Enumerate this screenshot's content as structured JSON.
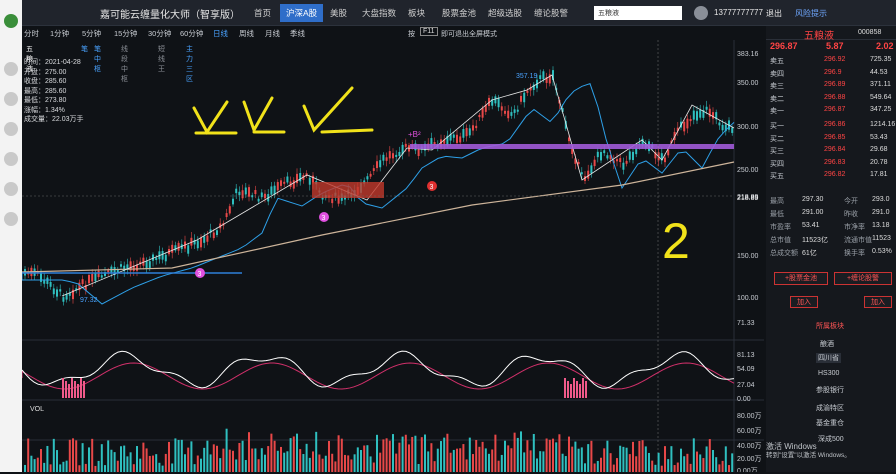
{
  "app": {
    "title": "嘉可能云缠量化大师（智享版）",
    "nav": [
      "首页",
      "沪深A股",
      "美股",
      "大盘指数",
      "板块",
      "股票金池",
      "超级选股",
      "缠论股警"
    ],
    "nav_active": "沪深A股",
    "search": "五粮液",
    "user": "13777777777",
    "logout": "退出",
    "alert": "风险提示"
  },
  "periods": [
    "分时",
    "1分钟",
    "5分钟",
    "15分钟",
    "30分钟",
    "60分钟",
    "日线",
    "周线",
    "月线",
    "季线"
  ],
  "period_selected": "日线",
  "tip": {
    "key_press": "按",
    "key": "F11",
    "label": "即可退出全屏模式"
  },
  "indicators": {
    "stock": "五粮液",
    "items": [
      "笔",
      "笔中枢",
      "线段中枢",
      "短线王",
      "主力三区"
    ]
  },
  "info": {
    "time": "时间：2021-04-28",
    "open": "开盘：275.00",
    "close": "收盘：285.60",
    "high": "最高：285.60",
    "low": "最低：273.80",
    "change": "涨幅：1.34%",
    "volume": "成交量：22.03万手"
  },
  "price_axis": [
    "383.16",
    "350.00",
    "300.00",
    "250.00",
    "218.89",
    "150.00",
    "100.00",
    "71.33"
  ],
  "osc_axis": [
    "81.13",
    "54.09",
    "27.04",
    "0.00"
  ],
  "vol_axis": [
    "80.00万",
    "60.00万",
    "40.00万",
    "20.00万",
    "0.00万"
  ],
  "vol_label": "VOL",
  "annotations": {
    "peak": "357.19",
    "low": "97.32",
    "b2": "+B²",
    "crosshair": "218.89",
    "handwritten_number": "2"
  },
  "markers": [
    "3",
    "3",
    "3"
  ],
  "quote": {
    "name": "五粮液",
    "code": "000858",
    "price": "296.87",
    "change": "5.87",
    "pct": "2.02",
    "asks": [
      [
        "卖五",
        "296.92",
        "725.35"
      ],
      [
        "卖四",
        "296.9",
        "44.53"
      ],
      [
        "卖三",
        "296.89",
        "371.11"
      ],
      [
        "卖二",
        "296.88",
        "549.64"
      ],
      [
        "卖一",
        "296.87",
        "347.25"
      ]
    ],
    "bids": [
      [
        "买一",
        "296.86",
        "1214.16"
      ],
      [
        "买二",
        "296.85",
        "53.43"
      ],
      [
        "买三",
        "296.84",
        "29.68"
      ],
      [
        "买四",
        "296.83",
        "20.78"
      ],
      [
        "买五",
        "296.82",
        "17.81"
      ]
    ],
    "stats": [
      [
        "最高",
        "297.30",
        "今开",
        "293.0"
      ],
      [
        "最低",
        "291.00",
        "昨收",
        "291.0"
      ],
      [
        "市盈率",
        "53.41",
        "市净率",
        "13.18"
      ],
      [
        "总市值",
        "11523亿",
        "流通市值",
        "11523"
      ],
      [
        "总成交额",
        "61亿",
        "换手率",
        "0.53%"
      ]
    ],
    "add_pool": "+股票金池",
    "add_alert": "+缠论股警",
    "add": "加入",
    "add2": "加入"
  },
  "sectors": {
    "header": "所属板块",
    "items": [
      "酿酒",
      "四川省",
      "HS300",
      "参股银行",
      "成渝特区",
      "基金重仓",
      "深成500"
    ]
  },
  "watermark": {
    "line1": "激活 Windows",
    "line2": "转到\"设置\"以激活 Windows。"
  }
}
